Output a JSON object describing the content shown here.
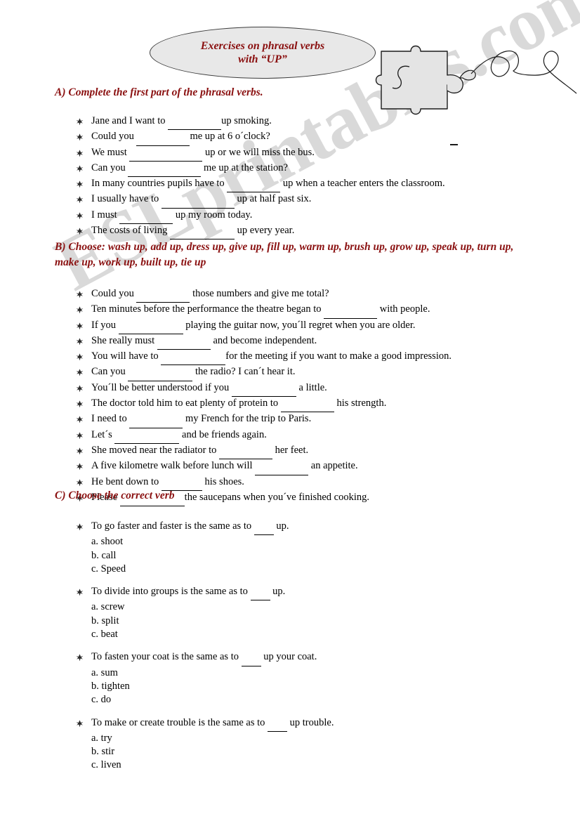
{
  "watermark": {
    "text": "ESLprintables.com"
  },
  "title": {
    "line1": "Exercises on phrasal verbs",
    "line2": "with  “UP”"
  },
  "decoration": {
    "puzzle_piece": "jigsaw-puzzle-piece",
    "squiggle": "curly-line"
  },
  "sections": {
    "a": {
      "heading": "A) Complete the first part of the phrasal verbs.",
      "items": [
        {
          "pre": "Jane and I want to ",
          "blank": "b-md",
          "post": "up smoking."
        },
        {
          "pre": "Could you ",
          "blank": "b-md",
          "post": "me up at 6 o´clock?"
        },
        {
          "pre": "We must ",
          "blank": "b-xl",
          "post": " up or we will miss the bus."
        },
        {
          "pre": "Can you ",
          "blank": "b-xl",
          "post": " me up at the station?"
        },
        {
          "pre": "In many countries pupils have to ",
          "blank": "b-md",
          "post": " up when a teacher enters the classroom."
        },
        {
          "pre": "I usually have to ",
          "blank": "b-xl",
          "post": " up at half past six."
        },
        {
          "pre": "I must ",
          "blank": "b-md",
          "post": " up my room today."
        },
        {
          "pre": "The costs of living ",
          "blank": "b-lg",
          "post": " up every year."
        }
      ]
    },
    "b": {
      "heading": "B) Choose: wash up, add up, dress up,  give up, fill up, warm up, brush up, grow up, speak up, turn up, make up, work up, built up, tie up",
      "word_bank": [
        "wash up",
        "add up",
        "dress up",
        "give up",
        "fill up",
        "warm up",
        "brush up",
        "grow up",
        "speak up",
        "turn up",
        "make up",
        "work up",
        "built up",
        "tie up"
      ],
      "items": [
        {
          "pre": "Could you ",
          "blank": "b-md",
          "post": " those numbers and give me total?"
        },
        {
          "pre": "Ten minutes before the performance the theatre began to ",
          "blank": "b-md",
          "post": " with people."
        },
        {
          "pre": "If you ",
          "blank": "b-lg",
          "post": " playing the guitar now, you´ll regret when you are older."
        },
        {
          "pre": "She really must ",
          "blank": "b-md",
          "post": " and become independent."
        },
        {
          "pre": "You will have to ",
          "blank": "b-lg",
          "post": "for the meeting if you want to make a good impression."
        },
        {
          "pre": "Can you ",
          "blank": "b-lg",
          "post": " the radio? I can´t hear it."
        },
        {
          "pre": "You´ll  be better understood if you ",
          "blank": "b-lg",
          "post": " a little."
        },
        {
          "pre": "The doctor told him to eat plenty of protein to ",
          "blank": "b-md",
          "post": " his strength."
        },
        {
          "pre": "I need to ",
          "blank": "b-md",
          "post": " my French for the trip to Paris."
        },
        {
          "pre": "Let´s ",
          "blank": "b-lg",
          "post": " and be friends again."
        },
        {
          "pre": "She moved near the radiator to ",
          "blank": "b-md",
          "post": " her feet."
        },
        {
          "pre": "A five kilometre walk before lunch will ",
          "blank": "b-md",
          "post": " an appetite."
        },
        {
          "pre": "He bent down to ",
          "blank": "b-sm",
          "post": " his shoes."
        },
        {
          "pre": "Please ",
          "blank": "b-lg",
          "post": "the saucepans when you´ve finished cooking."
        }
      ]
    },
    "c": {
      "heading": "C) Choose the correct verb",
      "questions": [
        {
          "pre": "To go faster and faster is the same as to ",
          "post": " up.",
          "options": [
            "a. shoot",
            "b. call",
            "c. Speed"
          ]
        },
        {
          "pre": "To divide into groups is the same as to ",
          "post": " up.",
          "options": [
            "a. screw",
            "b. split",
            "c. beat"
          ]
        },
        {
          "pre": "To fasten your coat is the same as to ",
          "post": " up your coat.",
          "options": [
            "a. sum",
            "b. tighten",
            "c. do"
          ]
        },
        {
          "pre": "To make or create trouble is the same as to ",
          "post": " up trouble.",
          "options": [
            "a. try",
            "b. stir",
            "c. liven"
          ]
        }
      ]
    }
  },
  "colors": {
    "heading": "#8a1010",
    "balloon_fill": "#e8e8e8",
    "watermark": "#d9d9d9",
    "text": "#000000"
  }
}
